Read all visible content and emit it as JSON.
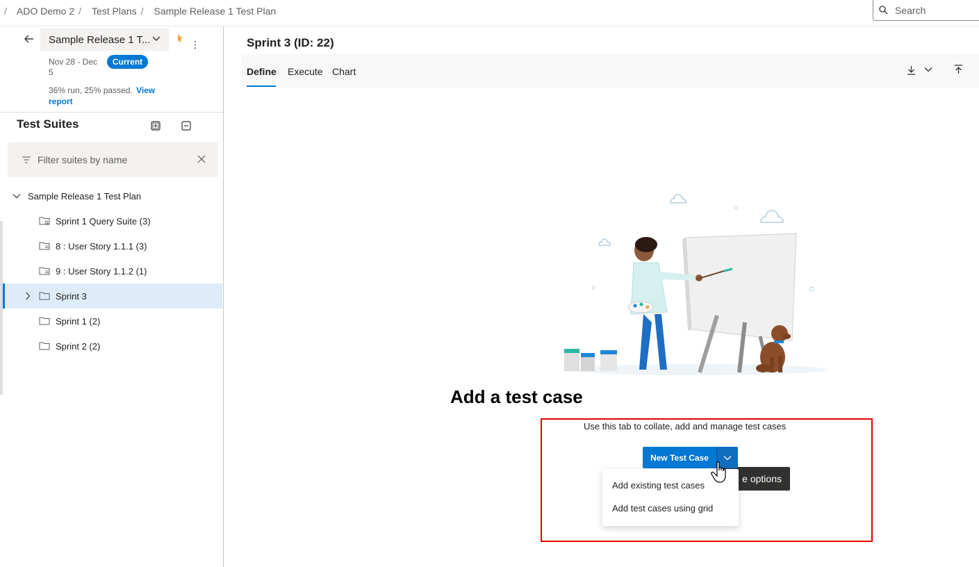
{
  "breadcrumb": {
    "items": [
      "ADO Demo 2",
      "Test Plans",
      "Sample Release 1 Test Plan"
    ]
  },
  "search": {
    "placeholder": "Search"
  },
  "plan": {
    "name": "Sample Release 1 T...",
    "dates": "Nov 28 - Dec 5",
    "badge": "Current",
    "stats": "36% run, 25% passed.",
    "view_report": "View report"
  },
  "suites": {
    "title": "Test Suites",
    "filter_placeholder": "Filter suites by name",
    "tree": [
      {
        "label": "Sample Release 1 Test Plan",
        "type": "root",
        "expanded": true
      },
      {
        "label": "Sprint 1 Query Suite (3)",
        "type": "query"
      },
      {
        "label": "8 : User Story 1.1.1 (3)",
        "type": "requirement"
      },
      {
        "label": "9 : User Story 1.1.2 (1)",
        "type": "requirement"
      },
      {
        "label": "Sprint 3",
        "type": "static",
        "selected": true,
        "collapsed": true
      },
      {
        "label": "Sprint 1 (2)",
        "type": "static"
      },
      {
        "label": "Sprint 2 (2)",
        "type": "static"
      }
    ]
  },
  "main": {
    "title": "Sprint 3 (ID: 22)",
    "tabs": [
      {
        "label": "Define",
        "active": true
      },
      {
        "label": "Execute",
        "active": false
      },
      {
        "label": "Chart",
        "active": false
      }
    ],
    "empty_title": "Add a test case",
    "empty_subtitle": "Use this tab to collate, add and manage test cases",
    "new_test_case": "New Test Case",
    "tooltip": "e options",
    "menu": [
      "Add existing test cases",
      "Add test cases using grid"
    ]
  },
  "colors": {
    "accent": "#0078d4",
    "selected_bg": "#deecf9",
    "highlight_box": "#e00000"
  }
}
